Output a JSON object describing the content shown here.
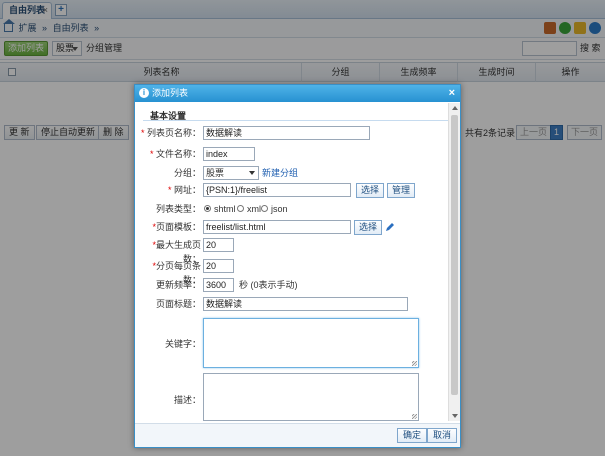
{
  "tabs": [
    {
      "label": "自由列表",
      "close": "×"
    }
  ],
  "tab_add": "+",
  "breadcrumb": {
    "home": "扩展",
    "sep": "»",
    "current": "自由列表"
  },
  "toolbar": {
    "add_label": "添加列表",
    "dropdown_value": "股票",
    "group_label": "分组管理",
    "search_label": "搜 索"
  },
  "table": {
    "headers": [
      "列表名称",
      "分组",
      "生成频率",
      "生成时间",
      "操作"
    ]
  },
  "footer": {
    "update_label": "更 新",
    "stop_label": "停止自动更新",
    "delete_label": "删 除",
    "record_text": "共有2条记录",
    "prev_label": "上一页",
    "page": "1",
    "next_label": "下一页"
  },
  "dialog": {
    "title": "添加列表",
    "close": "×",
    "section": "基本设置",
    "fields": {
      "list_name_label": "列表页名称：",
      "list_name_value": "数据解读",
      "file_name_label": "文件名称：",
      "file_name_value": "index",
      "group_label": "分组：",
      "group_value": "股票",
      "new_group_label": "新建分组",
      "url_label": "网址：",
      "url_value": "{PSN:1}/freelist",
      "url_select_label": "选择",
      "url_manage_label": "管理",
      "type_label": "列表类型：",
      "type_options": [
        "shtml",
        "xml",
        "json"
      ],
      "type_selected": "shtml",
      "template_label": "页面模板：",
      "template_value": "freelist/list.html",
      "template_select_label": "选择",
      "max_pages_label": "最大生成页数：",
      "max_pages_value": "20",
      "per_page_label": "分页每页条数：",
      "per_page_value": "20",
      "freq_label": "更新频率：",
      "freq_value": "3600",
      "freq_unit": "秒 (0表示手动)",
      "page_title_label": "页面标题：",
      "page_title_value": "数据解读",
      "keywords_label": "关键字：",
      "desc_label": "描述："
    },
    "ok_label": "确定",
    "cancel_label": "取消"
  },
  "colors": {
    "accent": "#2791d1",
    "add_green": "#6ab33f",
    "required": "#dd0000"
  }
}
